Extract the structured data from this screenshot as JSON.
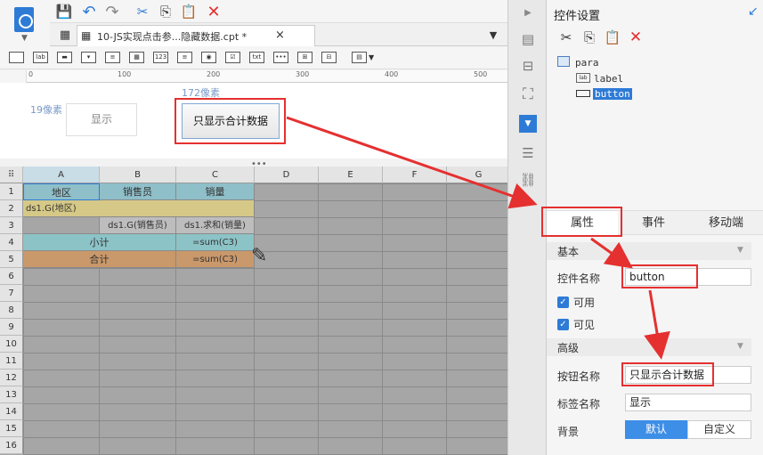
{
  "tab": {
    "title": "10-JS实现点击参...隐藏数据.cpt *",
    "close": "×"
  },
  "canvas": {
    "label_height": "19像素",
    "label_width": "172像素",
    "widget_label": "显示",
    "widget_button": "只显示合计数据"
  },
  "ruler": [
    "0",
    "100",
    "200",
    "300",
    "400",
    "500"
  ],
  "sheet": {
    "columns": [
      "A",
      "B",
      "C",
      "D",
      "E",
      "F",
      "G"
    ],
    "rows": [
      "1",
      "2",
      "3",
      "4",
      "5",
      "6",
      "7",
      "8",
      "9",
      "10",
      "11",
      "12",
      "13",
      "14",
      "15",
      "16"
    ],
    "cells": {
      "a1": "地区",
      "b1": "销售员",
      "c1": "销量",
      "a2": "ds1.G(地区)",
      "b3": "ds1.G(销售员)",
      "c3": "ds1.求和(销量)",
      "a4": "小计",
      "c4": "=sum(C3)",
      "a5": "合计",
      "c5": "=sum(C3)"
    }
  },
  "panel": {
    "title": "控件设置",
    "tree": {
      "root": "para",
      "child1": "label",
      "child2": "button"
    },
    "tabs": [
      "属性",
      "事件",
      "移动端"
    ],
    "section_basic": "基本",
    "field_name_label": "控件名称",
    "field_name_value": "button",
    "enabled_label": "可用",
    "visible_label": "可见",
    "section_advanced": "高级",
    "button_name_label": "按钮名称",
    "button_name_value": "只显示合计数据",
    "tag_name_label": "标签名称",
    "tag_name_value": "显示",
    "background_label": "背景",
    "background_options": [
      "默认",
      "自定义"
    ]
  },
  "colors": {
    "accent": "#2e7bd6",
    "red": "#e53030",
    "header_teal": "#8fbfc9",
    "subtotal_teal": "#8cc3c7",
    "total_orange": "#c9986b",
    "group_yellow": "#d6c987"
  }
}
